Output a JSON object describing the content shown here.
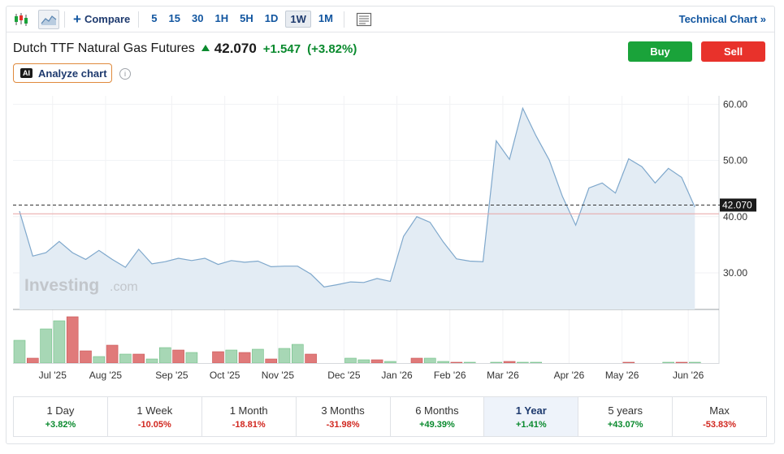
{
  "toolbar": {
    "compare_label": "Compare",
    "intervals": [
      "5",
      "15",
      "30",
      "1H",
      "5H",
      "1D",
      "1W",
      "1M"
    ],
    "active_interval": "1W",
    "technical_chart_label": "Technical Chart »"
  },
  "instrument": {
    "name": "Dutch TTF Natural Gas Futures",
    "last": "42.070",
    "change": "+1.547",
    "change_pct": "(+3.82%)",
    "direction_color": "#0a8a2e"
  },
  "actions": {
    "buy_label": "Buy",
    "sell_label": "Sell",
    "buy_color": "#1aa33a",
    "sell_color": "#e8322b"
  },
  "analyze": {
    "badge": "AI",
    "label": "Analyze chart",
    "info_glyph": "i"
  },
  "watermark": {
    "brand": "Investing",
    "suffix": ".com"
  },
  "chart_data": {
    "type": "area",
    "x_tick_labels": [
      "Jul '25",
      "Aug '25",
      "Sep '25",
      "Oct '25",
      "Nov '25",
      "Dec '25",
      "Jan '26",
      "Feb '26",
      "Mar '26",
      "Apr '26",
      "May '26",
      "Jun '26"
    ],
    "y_tick_labels": [
      "60.00",
      "50.00",
      "40.00",
      "30.00"
    ],
    "ylim": [
      23.5,
      61.5
    ],
    "y_ticks": [
      60,
      50,
      40,
      30
    ],
    "current_price": 42.07,
    "current_price_label": "42.070",
    "prev_close": 40.52,
    "x_ticks": [
      2.5,
      6.5,
      11.5,
      15.5,
      19.5,
      24.5,
      28.5,
      32.5,
      36.5,
      41.5,
      45.5,
      50.5
    ],
    "prices": [
      41.0,
      33.0,
      33.6,
      35.6,
      33.6,
      32.4,
      34.0,
      32.4,
      31.0,
      34.2,
      31.6,
      32.0,
      32.6,
      32.2,
      32.6,
      31.5,
      32.2,
      31.9,
      32.1,
      31.1,
      31.2,
      31.2,
      29.8,
      27.5,
      27.9,
      28.4,
      28.3,
      29.0,
      28.5,
      36.5,
      40.0,
      39.0,
      35.5,
      32.5,
      32.1,
      32.0,
      53.5,
      50.2,
      59.3,
      54.4,
      50.1,
      43.6,
      38.5,
      45.1,
      46.0,
      44.2,
      50.3,
      48.9,
      46.0,
      48.6,
      47.0,
      41.7
    ],
    "volume_heights": [
      28,
      6,
      42,
      52,
      57,
      15,
      8,
      22,
      11,
      11,
      5,
      19,
      16,
      13,
      0,
      14,
      16,
      13,
      17,
      5,
      18,
      23,
      11,
      0,
      0,
      6,
      4,
      4,
      2,
      0,
      6,
      6,
      2,
      1,
      1,
      0,
      1,
      2,
      1,
      1,
      0,
      0,
      0,
      0,
      0,
      0,
      1,
      0,
      0,
      1,
      1,
      1
    ],
    "volume_up": [
      true,
      false,
      true,
      true,
      false,
      false,
      true,
      false,
      true,
      false,
      true,
      true,
      false,
      true,
      false,
      false,
      true,
      false,
      true,
      false,
      true,
      true,
      false,
      true,
      false,
      true,
      true,
      false,
      true,
      true,
      false,
      true,
      true,
      false,
      true,
      false,
      true,
      false,
      true,
      true,
      false,
      false,
      true,
      true,
      false,
      true,
      false,
      false,
      true,
      true,
      false,
      true
    ],
    "colors": {
      "line": "#7fa8cc",
      "area": "#e3ecf4",
      "up": "#a7d7b5",
      "down": "#e07a7a",
      "prev_close": "#e8a3a3"
    }
  },
  "periods": [
    {
      "label": "1 Day",
      "value": "+3.82%",
      "sign": "pos"
    },
    {
      "label": "1 Week",
      "value": "-10.05%",
      "sign": "neg"
    },
    {
      "label": "1 Month",
      "value": "-18.81%",
      "sign": "neg"
    },
    {
      "label": "3 Months",
      "value": "-31.98%",
      "sign": "neg"
    },
    {
      "label": "6 Months",
      "value": "+49.39%",
      "sign": "pos"
    },
    {
      "label": "1 Year",
      "value": "+1.41%",
      "sign": "pos"
    },
    {
      "label": "5 years",
      "value": "+43.07%",
      "sign": "pos"
    },
    {
      "label": "Max",
      "value": "-53.83%",
      "sign": "neg"
    }
  ],
  "active_period": "1 Year"
}
